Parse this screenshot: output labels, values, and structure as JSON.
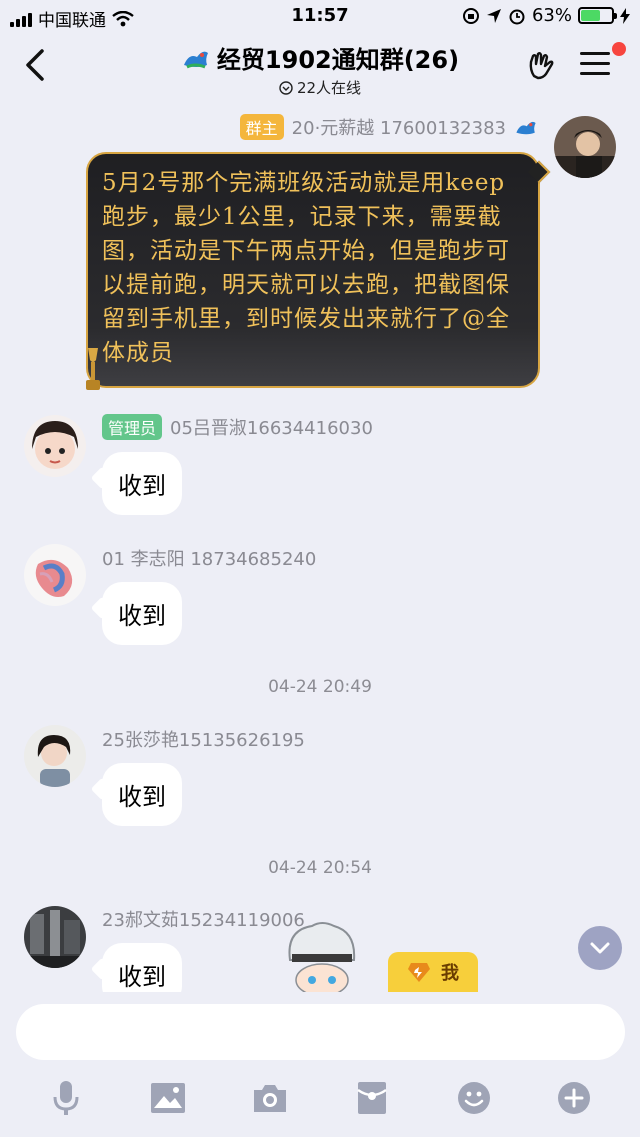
{
  "status_bar": {
    "carrier": "中国联通",
    "time": "11:57",
    "battery": "63%"
  },
  "header": {
    "title": "经贸1902通知群(26)",
    "online": "22人在线"
  },
  "messages": [
    {
      "badge": "群主",
      "sender": "20·元薪越 17600132383",
      "text": "5月2号那个完满班级活动就是用keep跑步，最少1公里，记录下来，需要截图，活动是下午两点开始，但是跑步可以提前跑，明天就可以去跑，把截图保留到手机里，到时候发出来就行了@全体成员"
    },
    {
      "badge": "管理员",
      "sender": "05吕晋淑16634416030",
      "text": "收到"
    },
    {
      "sender": "01 李志阳 18734685240",
      "text": "收到"
    },
    {
      "sender": "25张莎艳15135626195",
      "text": "收到"
    },
    {
      "sender": "23郝文茹15234119006",
      "text": "收到"
    }
  ],
  "times": [
    "04-24 20:49",
    "04-24 20:54"
  ],
  "me_label": "我",
  "colors": {
    "background": "#edeef6",
    "owner_badge": "#f4b63c",
    "admin_badge": "#63c68b",
    "special_text": "#f0c15a",
    "special_border": "#d7a542"
  }
}
